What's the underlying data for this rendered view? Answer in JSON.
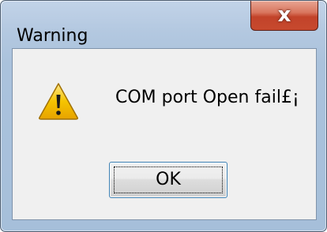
{
  "window": {
    "title": "Warning",
    "close_glyph": "x"
  },
  "dialog": {
    "icon": "warning-icon",
    "message": "COM port Open fail£¡",
    "ok_label": "OK"
  },
  "colors": {
    "frame": "#a6bfda",
    "client": "#f0f0f0",
    "close_button": "#c7492e",
    "warning_yellow": "#f5c400"
  }
}
